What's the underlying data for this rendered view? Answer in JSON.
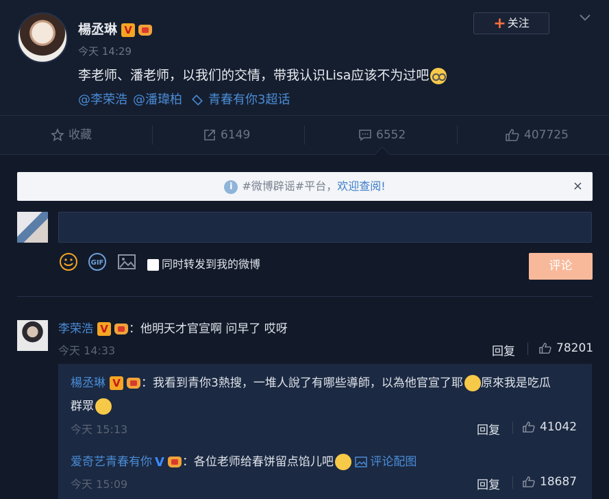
{
  "post": {
    "author": "楊丞琳",
    "time": "今天 14:29",
    "text": "李老师、潘老师，以我们的交情，带我认识Lisa应该不为过吧",
    "mentions": [
      "@李荣浩",
      "@潘瑋柏"
    ],
    "topic": "青春有你3超话",
    "follow_label": "关注"
  },
  "actions": {
    "favorite_label": "收藏",
    "repost_count": "6149",
    "comment_count": "6552",
    "like_count": "407725"
  },
  "notice": {
    "prefix": "#微博辟谣#平台，",
    "link": "欢迎查阅!",
    "close": "×"
  },
  "composer": {
    "input_value": "",
    "forward_label": "同时转发到我的微博",
    "submit_label": "评论"
  },
  "comments": [
    {
      "name": "李荣浩",
      "text": "：他明天才官宣啊 问早了 哎呀",
      "time": "今天 14:33",
      "reply_label": "回复",
      "likes": "78201"
    }
  ],
  "replies": [
    {
      "name": "楊丞琳",
      "text1": "：我看到青你3熱搜，一堆人說了有哪些導師，以為他官宣了耶",
      "text2": "原來我是吃瓜",
      "text3": "群眾",
      "time": "今天 15:13",
      "reply_label": "回复",
      "likes": "41042"
    },
    {
      "name": "爱奇艺青春有你",
      "text": "：各位老师给春饼留点馅儿吧",
      "pic_link": "评论配图",
      "time": "今天 15:09",
      "reply_label": "回复",
      "likes": "18687"
    }
  ],
  "colors": {
    "background": "#121a2a",
    "link": "#4a8cd6",
    "accent_orange": "#ff6f3c",
    "submit": "#f8b99a"
  }
}
